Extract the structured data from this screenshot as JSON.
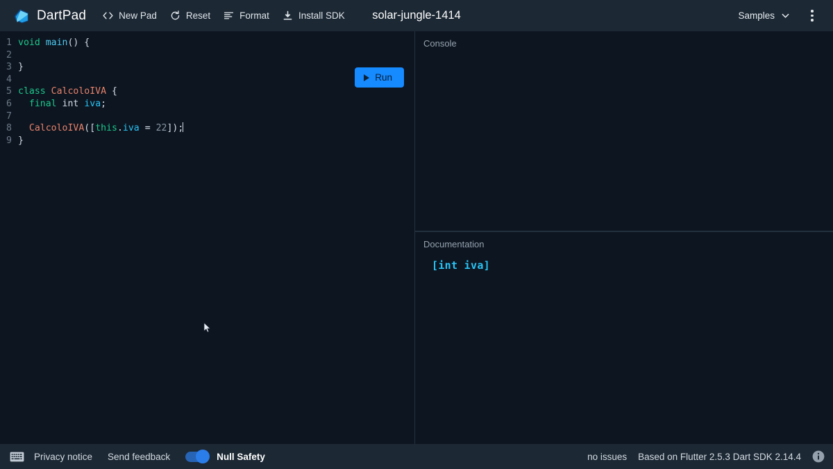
{
  "header": {
    "brand_name": "DartPad",
    "logo_icon": "dart-logo-icon",
    "pad_title": "solar-jungle-1414",
    "tools": [
      {
        "label": "New Pad",
        "icon": "code-brackets-icon"
      },
      {
        "label": "Reset",
        "icon": "refresh-icon"
      },
      {
        "label": "Format",
        "icon": "format-lines-icon"
      },
      {
        "label": "Install SDK",
        "icon": "download-icon"
      }
    ],
    "samples_label": "Samples",
    "samples_icon": "chevron-down-icon",
    "more_icon": "kebab-menu-icon"
  },
  "editor": {
    "run_label": "Run",
    "run_icon": "play-icon",
    "line_numbers": [
      "1",
      "2",
      "3",
      "4",
      "5",
      "6",
      "7",
      "8",
      "9"
    ],
    "lines": [
      "void main() {",
      "",
      "}",
      "",
      "class CalcoloIVA {",
      "  final int iva;",
      "",
      "  CalcoloIVA([this.iva = 22]);",
      "}"
    ]
  },
  "console": {
    "label": "Console",
    "output": ""
  },
  "documentation": {
    "label": "Documentation",
    "signature": "[int iva]"
  },
  "footer": {
    "keyboard_icon": "keyboard-icon",
    "privacy_label": "Privacy notice",
    "feedback_label": "Send feedback",
    "null_safety_label": "Null Safety",
    "null_safety_on": true,
    "issues_label": "no issues",
    "version_label": "Based on Flutter 2.5.3 Dart SDK 2.14.4",
    "info_icon": "info-icon"
  },
  "colors": {
    "accent_blue": "#168aff",
    "header_bg": "#1c2834",
    "editor_bg": "#0d1520",
    "keyword_green": "#1bc98b",
    "type_salmon": "#e8836b",
    "var_cyan": "#29c5f6",
    "number_grey": "#8a98a6"
  }
}
